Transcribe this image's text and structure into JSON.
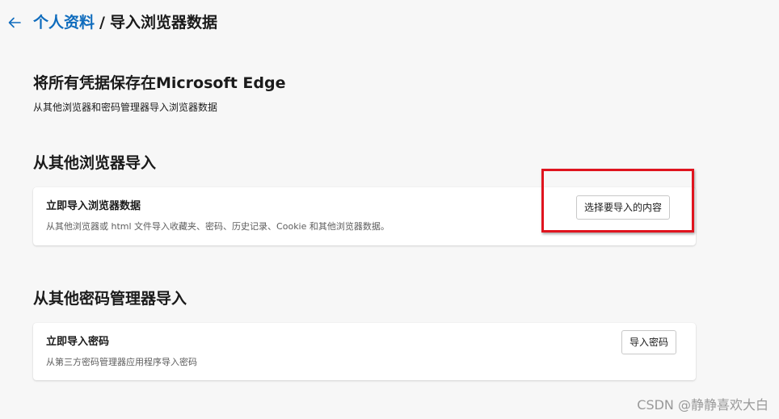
{
  "breadcrumb": {
    "parent": "个人资料",
    "separator": "/",
    "current": "导入浏览器数据"
  },
  "main": {
    "title": "将所有凭据保存在Microsoft Edge",
    "subtitle": "从其他浏览器和密码管理器导入浏览器数据"
  },
  "sections": [
    {
      "title": "从其他浏览器导入",
      "card": {
        "title": "立即导入浏览器数据",
        "description": "从其他浏览器或 html 文件导入收藏夹、密码、历史记录、Cookie 和其他浏览器数据。",
        "button_label": "选择要导入的内容"
      }
    },
    {
      "title": "从其他密码管理器导入",
      "card": {
        "title": "立即导入密码",
        "description": "从第三方密码管理器应用程序导入密码",
        "button_label": "导入密码"
      }
    }
  ],
  "watermark": "CSDN @静静喜欢大白",
  "colors": {
    "accent": "#0f6cbd",
    "highlight": "#e0141e",
    "background": "#f7f7f7"
  },
  "icons": {
    "back": "arrow-left-icon"
  }
}
